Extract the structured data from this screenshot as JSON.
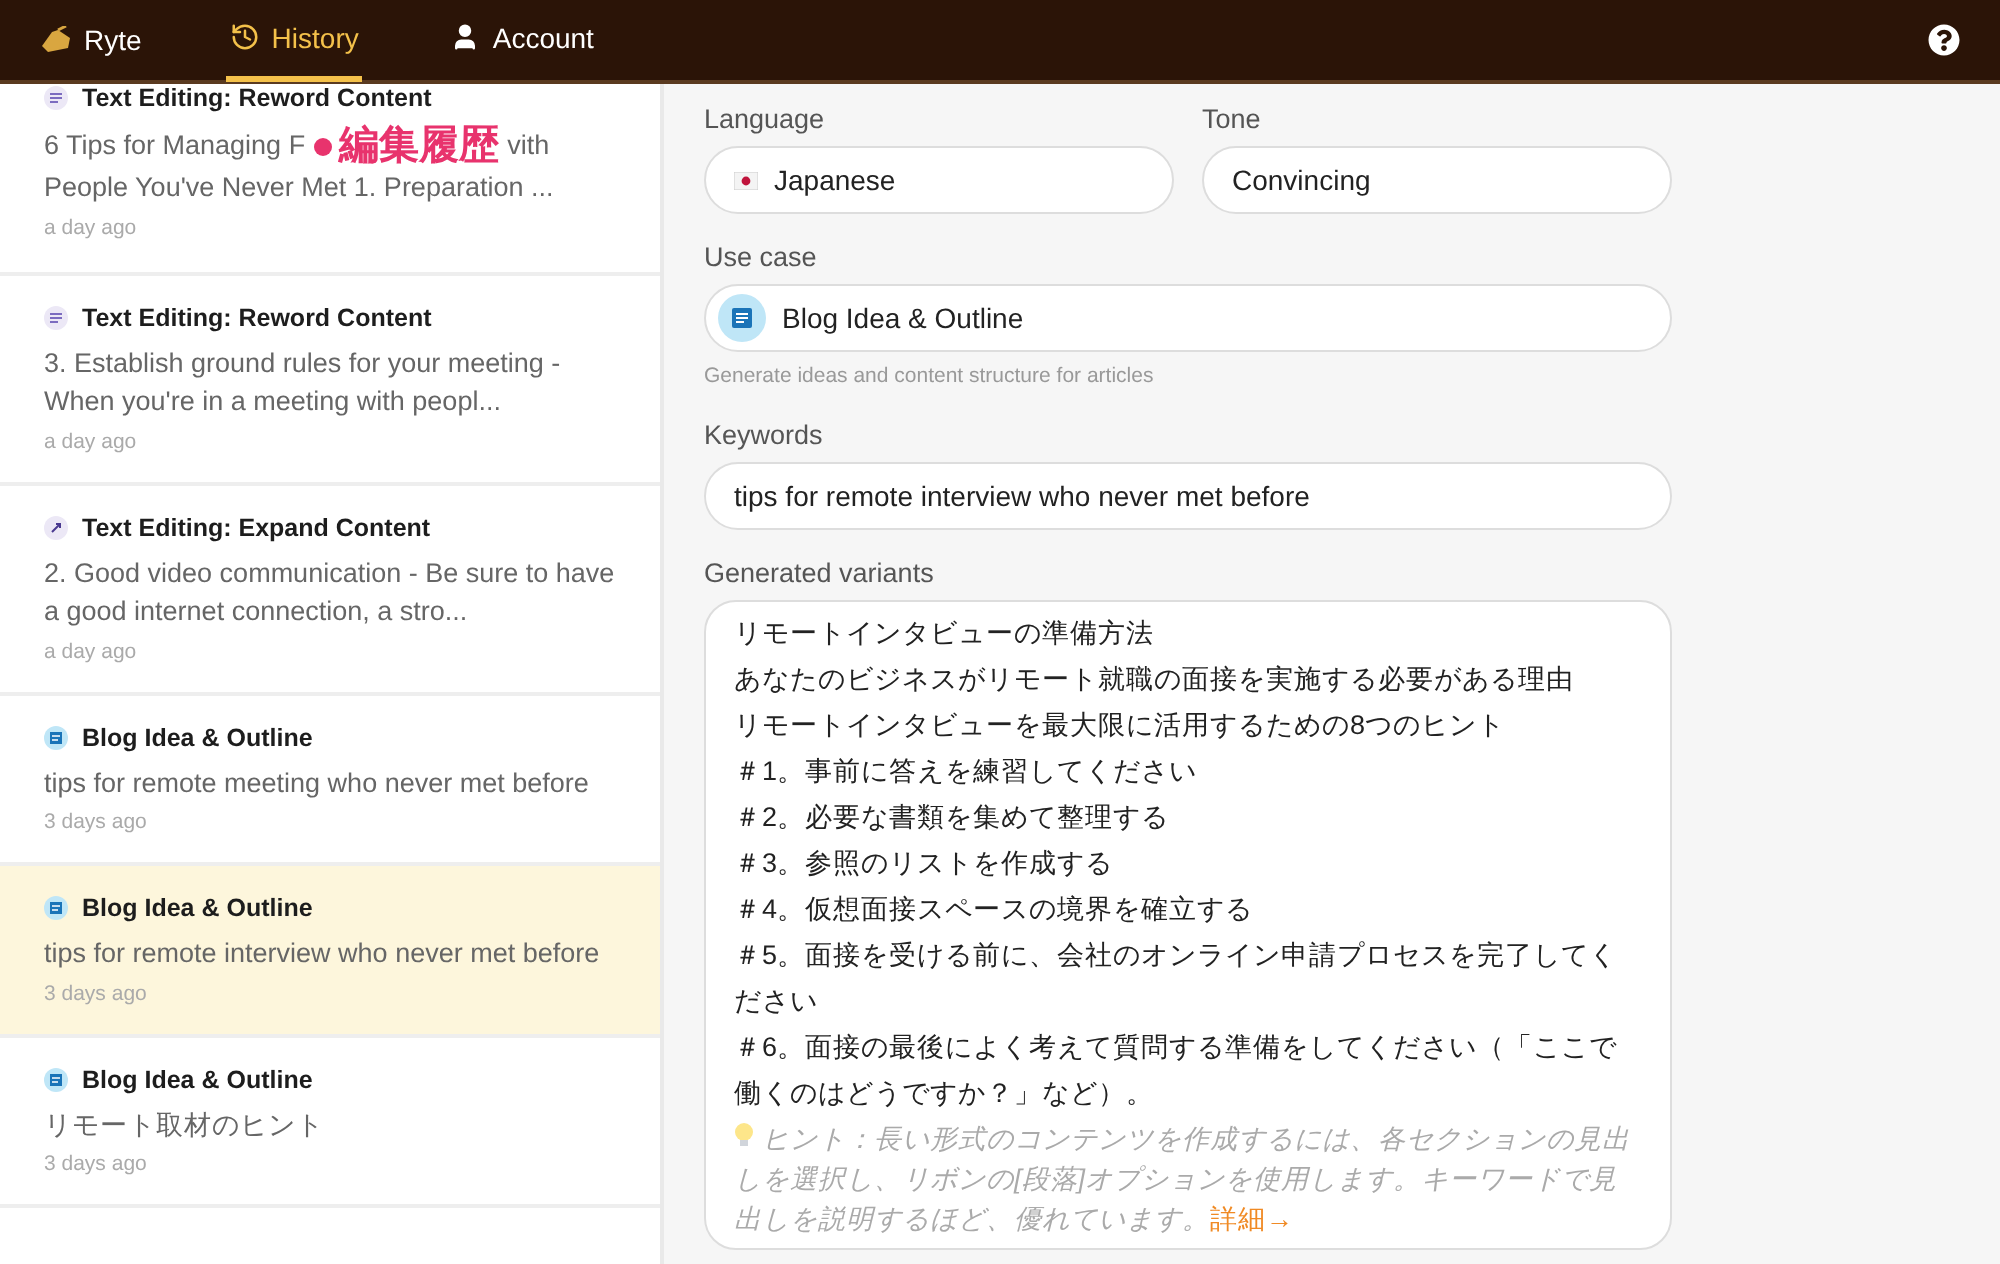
{
  "nav": {
    "brand": "Ryte",
    "tabs": [
      {
        "label": "History",
        "kind": "history",
        "selected": true
      },
      {
        "label": "Account",
        "kind": "account",
        "selected": false
      }
    ]
  },
  "history": [
    {
      "kind": "reword",
      "title": "Text Editing: Reword Content",
      "body": [
        "6 Tips for Managing F",
        "vith",
        "People You've Never Met 1. Preparation ..."
      ],
      "time": "a day ago",
      "selected": false,
      "annotation": "編集履歴"
    },
    {
      "kind": "reword",
      "title": "Text Editing: Reword Content",
      "body": "3. Establish ground rules for your meeting - When you're in a meeting with peopl...",
      "time": "a day ago",
      "selected": false
    },
    {
      "kind": "expand",
      "title": "Text Editing: Expand Content",
      "body": "2. Good video communication - Be sure to have a good internet connection, a stro...",
      "time": "a day ago",
      "selected": false
    },
    {
      "kind": "blog",
      "title": "Blog Idea & Outline",
      "body": "tips for remote meeting who never met before",
      "time": "3 days ago",
      "selected": false
    },
    {
      "kind": "blog",
      "title": "Blog Idea & Outline",
      "body": "tips for remote interview who never met before",
      "time": "3 days ago",
      "selected": true
    },
    {
      "kind": "blog",
      "title": "Blog Idea & Outline",
      "body": "リモート取材のヒント",
      "time": "3 days ago",
      "selected": false
    }
  ],
  "form": {
    "language": {
      "label": "Language",
      "value": "Japanese"
    },
    "tone": {
      "label": "Tone",
      "value": "Convincing"
    },
    "use_case": {
      "label": "Use case",
      "value": "Blog Idea & Outline",
      "help": "Generate ideas and content structure for articles"
    },
    "keywords": {
      "label": "Keywords",
      "value": "tips for remote interview who never met before"
    },
    "variants": {
      "label": "Generated variants",
      "lines": [
        "リモートインタビューの準備方法",
        "あなたのビジネスがリモート就職の面接を実施する必要がある理由",
        "リモートインタビューを最大限に活用するための8つのヒント",
        "＃1。事前に答えを練習してください",
        "＃2。必要な書類を集めて整理する",
        "＃3。参照のリストを作成する",
        "＃4。仮想面接スペースの境界を確立する",
        "＃5。面接を受ける前に、会社のオンライン申請プロセスを完了してください",
        "＃6。面接の最後によく考えて質問する準備をしてください（「ここで働くのはどうですか？」など）。"
      ],
      "hint": "ヒント：長い形式のコンテンツを作成するには、各セクションの見出しを選択し、リボンの[段落]オプションを使用します。キーワードで見出しを説明するほど、優れています。",
      "hint_link": "詳細→"
    }
  }
}
